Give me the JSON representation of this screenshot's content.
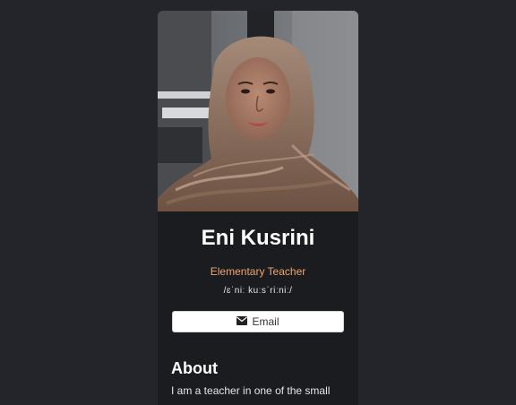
{
  "profile": {
    "name": "Eni Kusrini",
    "role": "Elementary Teacher",
    "pronunciation": "/ɛˈniː kuːsˈriːniː/",
    "photo_alt": "Eni Kusrini"
  },
  "contact": {
    "email_label": "Email",
    "email_icon": "envelope-icon"
  },
  "about": {
    "heading": "About",
    "text": "I am a teacher in one of the small"
  },
  "colors": {
    "page_bg": "#23252b",
    "card_bg": "#1b1c20",
    "accent": "#f0a36d"
  }
}
